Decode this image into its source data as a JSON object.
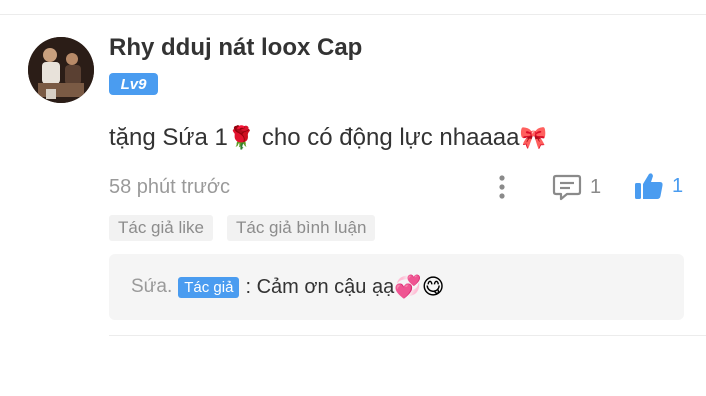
{
  "comment": {
    "username": "Rhy dduj nát loox Cap",
    "level": "Lv9",
    "text": "tặng Sứa 1",
    "rose_emoji": "🌹",
    "text_2": " cho có động lực nhaaaa",
    "ribbon_emoji": "🎀",
    "timestamp": "58 phút trước",
    "reply_count": "1",
    "like_count": "1"
  },
  "tags": [
    "Tác giả like",
    "Tác giả bình luận"
  ],
  "reply": {
    "author": "Sứa.",
    "author_badge": "Tác giả",
    "text": ": Cảm ơn cậu ạạ",
    "emojis": "💞😋"
  },
  "colors": {
    "accent": "#4a9cf0",
    "text": "#333333",
    "muted": "#9a9a9a",
    "reply_bg": "#f5f5f5"
  },
  "icons": {
    "more": "vertical-dots-icon",
    "reply": "comment-icon",
    "like": "thumbs-up-icon"
  }
}
